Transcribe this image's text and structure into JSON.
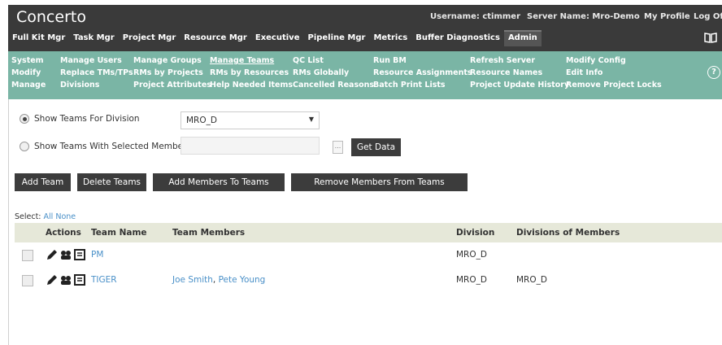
{
  "header": {
    "title": "Concerto",
    "username": "Username: ctimmer",
    "server": "Server Name: Mro-Demo",
    "profile": "My Profile",
    "logoff": "Log Off"
  },
  "mainnav": [
    "Full Kit Mgr",
    "Task Mgr",
    "Project Mgr",
    "Resource Mgr",
    "Executive",
    "Pipeline Mgr",
    "Metrics",
    "Buffer Diagnostics",
    "Admin"
  ],
  "submenu": {
    "col1": [
      "System",
      "Modify",
      "Manage"
    ],
    "col2": [
      "Manage Users",
      "Replace TMs/TPs",
      "Divisions"
    ],
    "col3": [
      "Manage Groups",
      "RMs by Projects",
      "Project Attributes"
    ],
    "col4": [
      "Manage Teams",
      "RMs by Resources",
      "Help Needed Items"
    ],
    "col5": [
      "QC List",
      "RMs Globally",
      "Cancelled Reasons"
    ],
    "col6": [
      "Run BM",
      "Resource Assignments",
      "Batch Print Lists"
    ],
    "col7": [
      "Refresh Server",
      "Resource Names",
      "Project Update History"
    ],
    "col8": [
      "Modify Config",
      "Edit Info",
      "Remove Project Locks"
    ]
  },
  "filters": {
    "radio_division": "Show Teams For Division",
    "division_value": "MRO_D",
    "radio_members": "Show Teams With Selected Members",
    "ellipsis": "...",
    "get_data": "Get Data"
  },
  "buttons": {
    "add_team": "Add Team",
    "delete_teams": "Delete Teams",
    "add_members": "Add Members To Teams",
    "remove_members": "Remove Members From Teams"
  },
  "select": {
    "label": "Select:",
    "all": "All",
    "none": "None"
  },
  "table": {
    "headers": [
      "Actions",
      "Team Name",
      "Team Members",
      "Division",
      "Divisions of Members"
    ],
    "rows": [
      {
        "team": "PM",
        "member1": "",
        "sep": "",
        "member2": "",
        "division": "MRO_D",
        "member_divisions": ""
      },
      {
        "team": "TIGER",
        "member1": "Joe Smith",
        "sep": ", ",
        "member2": "Pete Young",
        "division": "MRO_D",
        "member_divisions": "MRO_D"
      }
    ]
  }
}
